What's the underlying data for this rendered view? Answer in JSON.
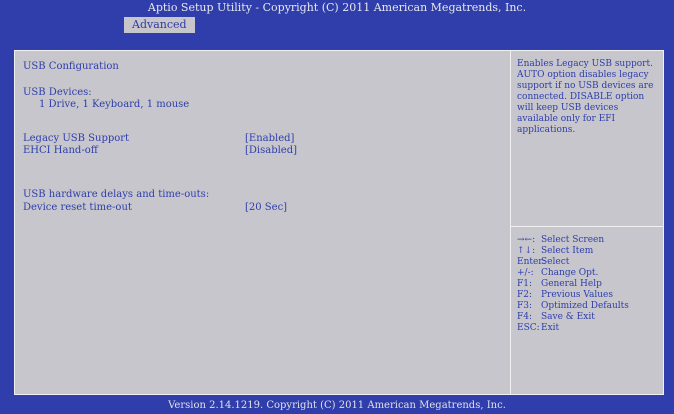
{
  "window": {
    "title": "Aptio Setup Utility - Copyright (C) 2011 American Megatrends, Inc."
  },
  "tabs": [
    {
      "label": "Advanced",
      "active": true
    }
  ],
  "left": {
    "section_title": "USB Configuration",
    "devices_label": "USB Devices:",
    "devices_value": "1 Drive, 1 Keyboard, 1 mouse",
    "options": [
      {
        "label": "Legacy USB Support",
        "value": "[Enabled]"
      },
      {
        "label": "EHCI Hand-off",
        "value": "[Disabled]"
      }
    ],
    "mass_storage_header": "USB hardware delays and time-outs:",
    "mass_storage_options": [
      {
        "label": "Device reset time-out",
        "value": "[20 Sec]"
      }
    ]
  },
  "help": {
    "text": "Enables Legacy USB support. AUTO option disables legacy support if no USB devices are connected. DISABLE option will keep USB devices available only for EFI applications."
  },
  "keys": [
    {
      "key": "→←:",
      "desc": "Select Screen"
    },
    {
      "key": "↑↓:",
      "desc": "Select Item"
    },
    {
      "key": "Enter:",
      "desc": "Select"
    },
    {
      "key": "+/-:",
      "desc": "Change Opt."
    },
    {
      "key": "F1:",
      "desc": "General Help"
    },
    {
      "key": "F2:",
      "desc": "Previous Values"
    },
    {
      "key": "F3:",
      "desc": "Optimized Defaults"
    },
    {
      "key": "F4:",
      "desc": "Save & Exit"
    },
    {
      "key": "ESC:",
      "desc": "Exit"
    }
  ],
  "footer": {
    "text": "Version 2.14.1219. Copyright (C) 2011 American Megatrends, Inc."
  },
  "colors": {
    "bios_blue": "#2f3eaa",
    "panel_gray": "#c6c6cc",
    "frame_white": "#f0f0f0"
  }
}
